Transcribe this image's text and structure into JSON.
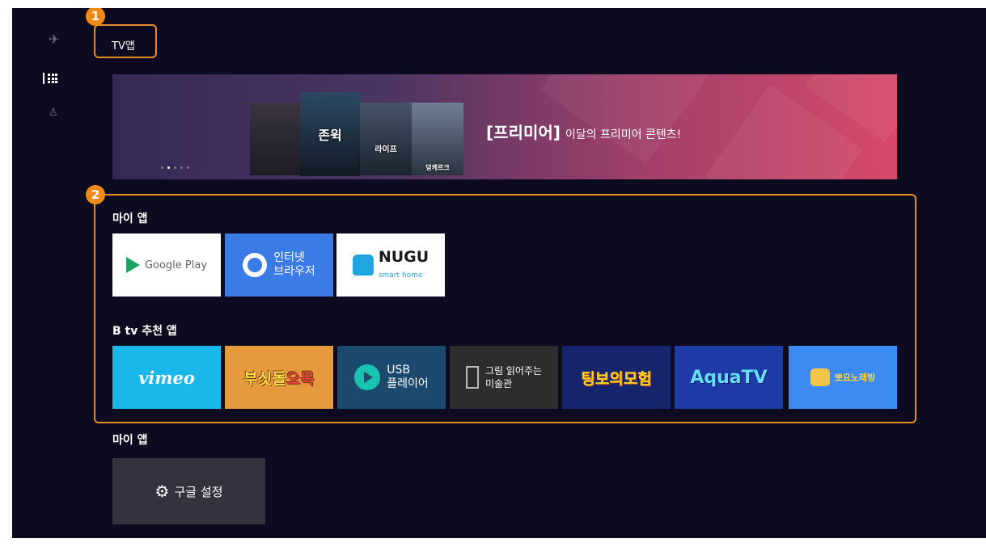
{
  "page": {
    "title": "TV앱"
  },
  "markers": {
    "one": "1",
    "two": "2"
  },
  "nav": {
    "icons": [
      "airplane-icon",
      "grid-icon",
      "person-icon"
    ]
  },
  "banner": {
    "badge": "[프리미어]",
    "text": "이달의 프리미어 콘텐츠!",
    "posters": [
      "존윅",
      "라이프",
      "덩케르크"
    ]
  },
  "my_apps": {
    "title": "마이 앱",
    "items": [
      {
        "label": "Google Play"
      },
      {
        "line1": "인터넷",
        "line2": "브라우저"
      },
      {
        "label": "NUGU",
        "sub": "smart home"
      }
    ]
  },
  "btv_apps": {
    "title": "B tv 추천 앱",
    "items": [
      {
        "label": "vimeo"
      },
      {
        "label_a": "부싯돌",
        "label_b": "오목"
      },
      {
        "line1": "USB",
        "line2": "플레이어"
      },
      {
        "line1": "그림 읽어주는",
        "line2": "미술관"
      },
      {
        "label": "팅보의모험"
      },
      {
        "label": "AquaTV"
      },
      {
        "label": "뽀요노래방"
      }
    ]
  },
  "my_apps2": {
    "title": "마이 앱",
    "settings_label": "구글 설정"
  },
  "colors": {
    "highlight": "#e98b2a",
    "background": "#0c0b1f"
  }
}
